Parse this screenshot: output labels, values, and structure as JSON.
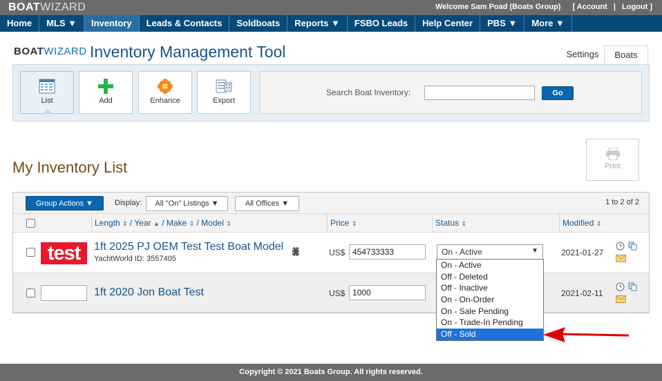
{
  "topbar": {
    "logo_a": "BOAT",
    "logo_b": "WIZARD",
    "welcome": "Welcome Sam Poad (Boats Group)",
    "account": "[ Account",
    "sep": "|",
    "logout": "Logout ]"
  },
  "nav": {
    "items": [
      "Home",
      "MLS ▼",
      "Inventory",
      "Leads & Contacts",
      "Soldboats",
      "Reports ▼",
      "FSBO Leads",
      "Help Center",
      "PBS ▼",
      "More ▼"
    ],
    "active": "Inventory"
  },
  "header": {
    "brand_a": "BOAT",
    "brand_b": "WIZARD",
    "title": "Inventory Management Tool",
    "tabs": [
      "Settings",
      "Boats"
    ]
  },
  "tools": {
    "list": "List",
    "add": "Add",
    "enhance": "Enhance",
    "export": "Export",
    "search_label": "Search Boat Inventory:",
    "search_value": "",
    "go": "Go"
  },
  "list": {
    "title": "My Inventory List",
    "print": "Print"
  },
  "table": {
    "group_actions": "Group Actions ▼",
    "display_label": "Display:",
    "display_filter": "All \"On\" Listings ▼",
    "offices_filter": "All Offices ▼",
    "pager": "1 to 2 of 2",
    "headers": {
      "length": "Length",
      "year": "Year",
      "make": "Make",
      "model": "Model",
      "price": "Price",
      "status": "Status",
      "modified": "Modified"
    },
    "rows": [
      {
        "thumb": "test",
        "title": "1ft 2025 PJ OEM Test Test Boat Model",
        "yachtworld_id": "YachtWorld ID: 3557405",
        "currency": "US$",
        "price": "454733333",
        "status": "On - Active",
        "modified": "2021-01-27"
      },
      {
        "thumb": "",
        "title": "1ft 2020 Jon Boat Test",
        "currency": "US$",
        "price": "1000",
        "modified": "2021-02-11"
      }
    ]
  },
  "status_options": [
    "On - Active",
    "Off - Deleted",
    "Off - Inactive",
    "On - On-Order",
    "On - Sale Pending",
    "On - Trade-In Pending",
    "Off - Sold"
  ],
  "status_highlighted": "Off - Sold",
  "footer": "Copyright © 2021 Boats Group. All rights reserved.",
  "colors": {
    "nav": "#074a7a",
    "accent": "#0a66b0",
    "highlight": "#1e73d8",
    "arrow": "#e00000"
  }
}
